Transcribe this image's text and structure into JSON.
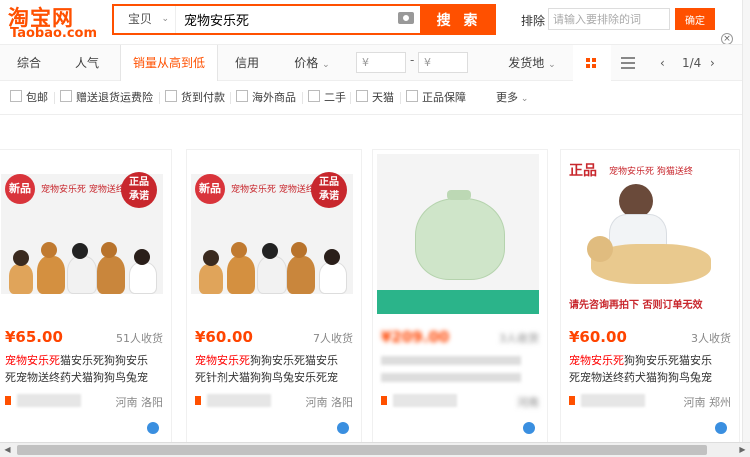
{
  "header": {
    "logo_cn": "淘宝网",
    "logo_en": "Taobao.com",
    "search_type": "宝贝",
    "search_query": "宠物安乐死",
    "search_button": "搜 索",
    "exclude_label": "排除",
    "exclude_placeholder": "请输入要排除的词",
    "confirm_button": "确定",
    "close": "×"
  },
  "sort": {
    "tabs": [
      "综合",
      "人气",
      "销量从高到低",
      "信用",
      "价格"
    ],
    "price_from": "¥",
    "price_to": "¥",
    "dash": "-",
    "ship_from": "发货地",
    "page": "1/4"
  },
  "filters": [
    "包邮",
    "赠送退货运费险",
    "货到付款",
    "海外商品",
    "二手",
    "天猫",
    "正品保障",
    "更多"
  ],
  "products": [
    {
      "price": "¥65.00",
      "sales": "51人收货",
      "title_hl": "宠物安乐死",
      "title_rest": "猫安乐死狗狗安乐死宠物送终药犬猫狗狗鸟兔宠",
      "location": "河南 洛阳",
      "banner_left": "新品",
      "banner_mid": "宠物安乐死  宠物送终",
      "banner_right_1": "正品",
      "banner_right_2": "承诺"
    },
    {
      "price": "¥60.00",
      "sales": "7人收货",
      "title_hl": "宠物安乐死",
      "title_rest": "狗狗安乐死猫安乐死针剂犬猫狗狗鸟兔安乐死宠",
      "location": "河南 洛阳",
      "banner_left": "新品",
      "banner_mid": "宠物安乐死  宠物送终",
      "banner_right_1": "正品",
      "banner_right_2": "承诺"
    },
    {
      "price": "¥209.00",
      "sales": "3人收货",
      "title_hl": "",
      "title_rest": "",
      "location": "河南"
    },
    {
      "price": "¥60.00",
      "sales": "3人收货",
      "title_hl": "宠物安乐死",
      "title_rest": "狗狗安乐死猫安乐死宠物送终药犬猫狗狗鸟兔宠",
      "location": "河南 郑州",
      "banner_left": "正品",
      "banner_mid": "宠物安乐死  狗猫送终",
      "banner_bottom": "请先咨询再拍下  否则订单无效"
    }
  ],
  "colors": {
    "brand": "#ff5000",
    "price": "#ff4400",
    "highlight": "#ff0000"
  }
}
